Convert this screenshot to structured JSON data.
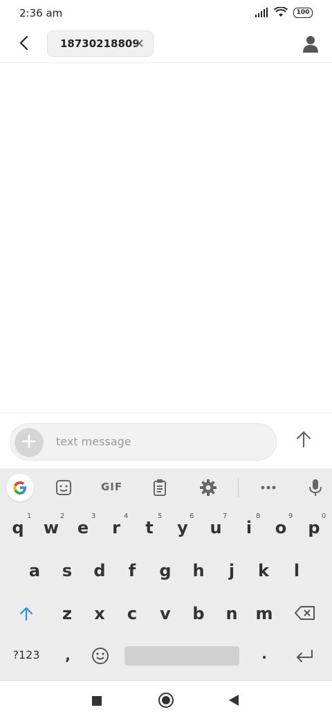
{
  "status_bar": {
    "time": "2:36 am",
    "battery": "100"
  },
  "header": {
    "recipient_number": "18730218809"
  },
  "compose": {
    "placeholder": "text message"
  },
  "keyboard": {
    "toolbar": {
      "gif_label": "GIF"
    },
    "row1": [
      {
        "key": "q",
        "hint": "1"
      },
      {
        "key": "w",
        "hint": "2"
      },
      {
        "key": "e",
        "hint": "3"
      },
      {
        "key": "r",
        "hint": "4"
      },
      {
        "key": "t",
        "hint": "5"
      },
      {
        "key": "y",
        "hint": "6"
      },
      {
        "key": "u",
        "hint": "7"
      },
      {
        "key": "i",
        "hint": "8"
      },
      {
        "key": "o",
        "hint": "9"
      },
      {
        "key": "p",
        "hint": "0"
      }
    ],
    "row2": [
      "a",
      "s",
      "d",
      "f",
      "g",
      "h",
      "j",
      "k",
      "l"
    ],
    "row3": [
      "z",
      "x",
      "c",
      "v",
      "b",
      "n",
      "m"
    ],
    "row4": {
      "symbols": "?123",
      "comma": ",",
      "period": "."
    }
  },
  "colors": {
    "accent_blue": "#2196f3",
    "keyboard_bg": "#ececec"
  }
}
